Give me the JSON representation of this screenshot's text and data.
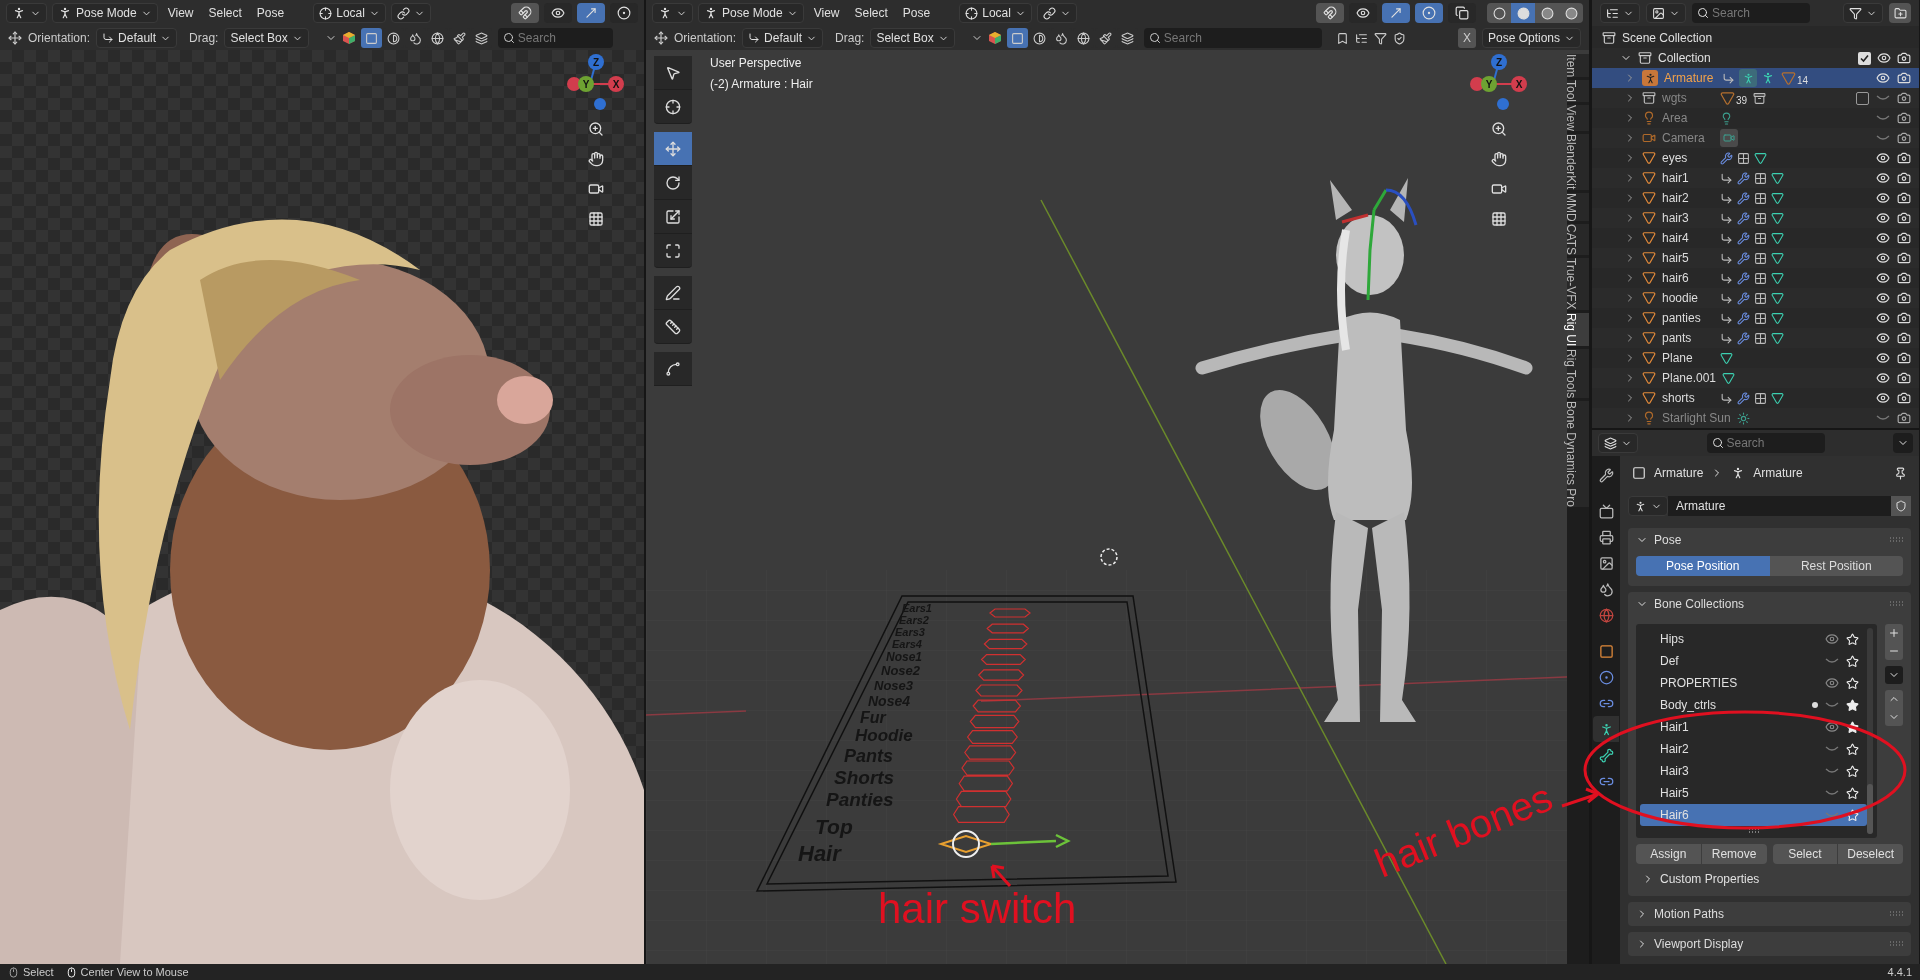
{
  "viewports": [
    {
      "kind": "render",
      "header": {
        "mode": "Pose Mode",
        "menus": [
          "View",
          "Select",
          "Pose"
        ],
        "pivot": "Local",
        "toggles": [
          {
            "kind": "snap",
            "on": true
          },
          {
            "kind": "visibility",
            "on": false
          },
          {
            "kind": "gizmo",
            "on": true
          },
          {
            "kind": "overlay",
            "on": false
          }
        ],
        "orientation_label": "Orientation:",
        "orientation": "Default",
        "drag_label": "Drag:",
        "drag": "Select Box",
        "filters": [
          {
            "kind": "bones",
            "selected": true
          },
          {
            "kind": "shading",
            "selected": false
          },
          {
            "kind": "lights",
            "selected": false
          },
          {
            "kind": "world",
            "selected": false
          },
          {
            "kind": "props",
            "selected": false
          },
          {
            "kind": "data",
            "selected": false
          }
        ],
        "search_placeholder": "Search"
      },
      "gizmo": {
        "x": "X",
        "y": "Y",
        "z": "Z"
      }
    },
    {
      "kind": "solid",
      "header": {
        "mode": "Pose Mode",
        "menus": [
          "View",
          "Select",
          "Pose"
        ],
        "pivot": "Local",
        "toggles": [
          {
            "kind": "snap",
            "on": true
          },
          {
            "kind": "visibility",
            "on": false
          },
          {
            "kind": "gizmo",
            "on": true
          },
          {
            "kind": "overlay",
            "on": true
          },
          {
            "kind": "xray",
            "on": false
          }
        ],
        "shading": [
          {
            "kind": "wireframe",
            "selected": false
          },
          {
            "kind": "solid",
            "selected": true
          },
          {
            "kind": "material",
            "selected": false
          },
          {
            "kind": "rendered",
            "selected": false
          }
        ],
        "orientation_label": "Orientation:",
        "orientation": "Default",
        "drag_label": "Drag:",
        "drag": "Select Box",
        "filters": [
          {
            "kind": "bones",
            "selected": true
          },
          {
            "kind": "shading",
            "selected": false
          },
          {
            "kind": "lights",
            "selected": false
          },
          {
            "kind": "world",
            "selected": false
          },
          {
            "kind": "props",
            "selected": false
          },
          {
            "kind": "data",
            "selected": false
          }
        ],
        "search_placeholder": "Search",
        "x_button": "X",
        "pose_options": "Pose Options"
      },
      "gizmo": {
        "x": "X",
        "y": "Y",
        "z": "Z"
      },
      "overlay_text": [
        "User Perspective",
        "(-2) Armature : Hair"
      ],
      "tools": [
        {
          "kind": "select",
          "selected": false
        },
        {
          "kind": "cursor",
          "selected": false
        },
        {
          "kind": "move",
          "selected": true
        },
        {
          "kind": "rotate",
          "selected": false
        },
        {
          "kind": "scale",
          "selected": false
        },
        {
          "kind": "transform",
          "selected": false
        },
        {
          "kind": "annotate",
          "selected": false
        },
        {
          "kind": "measure",
          "selected": false
        },
        {
          "kind": "bend",
          "selected": false
        }
      ],
      "switch_labels": [
        "Ears1",
        "Ears2",
        "Ears3",
        "Ears4",
        "Nose1",
        "Nose2",
        "Nose3",
        "Nose4",
        "Fur",
        "Hoodie",
        "Pants",
        "Shorts",
        "Panties",
        "Top",
        "Hair"
      ],
      "sidebar_tabs": [
        {
          "label": "Item",
          "selected": false
        },
        {
          "label": "Tool",
          "selected": false
        },
        {
          "label": "View",
          "selected": false
        },
        {
          "label": "BlenderKit",
          "selected": false
        },
        {
          "label": "MMD",
          "selected": false
        },
        {
          "label": "CATS",
          "selected": false
        },
        {
          "label": "True-VFX",
          "selected": false
        },
        {
          "label": "Rig UI",
          "selected": true
        },
        {
          "label": "Rig Tools",
          "selected": false
        },
        {
          "label": "Bone Dynamics Pro",
          "selected": false
        }
      ]
    }
  ],
  "outliner": {
    "search_placeholder": "Search",
    "scene": "Scene Collection",
    "collection": {
      "label": "Collection",
      "checked": true
    },
    "items": [
      {
        "name": "Armature",
        "kind": "armature",
        "selected": true,
        "visible": true,
        "badge": "14"
      },
      {
        "name": "wgts",
        "kind": "collection",
        "selected": false,
        "visible": false,
        "checked": false,
        "badge": "39"
      },
      {
        "name": "Area",
        "kind": "light",
        "selected": false,
        "visible": false
      },
      {
        "name": "Camera",
        "kind": "camera",
        "selected": false,
        "visible": false
      },
      {
        "name": "eyes",
        "kind": "mesh_modified",
        "selected": false,
        "visible": true
      },
      {
        "name": "hair1",
        "kind": "mesh_rigged",
        "selected": false,
        "visible": true
      },
      {
        "name": "hair2",
        "kind": "mesh_rigged",
        "selected": false,
        "visible": true
      },
      {
        "name": "hair3",
        "kind": "mesh_rigged",
        "selected": false,
        "visible": true
      },
      {
        "name": "hair4",
        "kind": "mesh_rigged",
        "selected": false,
        "visible": true
      },
      {
        "name": "hair5",
        "kind": "mesh_rigged",
        "selected": false,
        "visible": true
      },
      {
        "name": "hair6",
        "kind": "mesh_rigged",
        "selected": false,
        "visible": true
      },
      {
        "name": "hoodie",
        "kind": "mesh_rigged",
        "selected": false,
        "visible": true
      },
      {
        "name": "panties",
        "kind": "mesh_rigged",
        "selected": false,
        "visible": true
      },
      {
        "name": "pants",
        "kind": "mesh_rigged",
        "selected": false,
        "visible": true
      },
      {
        "name": "Plane",
        "kind": "mesh",
        "selected": false,
        "visible": true
      },
      {
        "name": "Plane.001",
        "kind": "mesh",
        "selected": false,
        "visible": true
      },
      {
        "name": "shorts",
        "kind": "mesh_rigged",
        "selected": false,
        "visible": true
      },
      {
        "name": "Starlight Sun",
        "kind": "sun_light",
        "selected": false,
        "visible": false
      }
    ]
  },
  "properties": {
    "search_placeholder": "Search",
    "tabs": [
      {
        "kind": "tool",
        "selected": false
      },
      {
        "kind": "render",
        "selected": false
      },
      {
        "kind": "output",
        "selected": false
      },
      {
        "kind": "view_layer",
        "selected": false
      },
      {
        "kind": "scene",
        "selected": false
      },
      {
        "kind": "world",
        "selected": false
      },
      {
        "kind": "object",
        "selected": false
      },
      {
        "kind": "physics",
        "selected": false
      },
      {
        "kind": "constraints",
        "selected": false
      },
      {
        "kind": "data",
        "selected": true
      },
      {
        "kind": "bone",
        "selected": false
      },
      {
        "kind": "bone_constraints",
        "selected": false
      }
    ],
    "breadcrumb": [
      "Armature",
      "Armature"
    ],
    "data_name": "Armature",
    "pose_panel": {
      "title": "Pose",
      "expanded": true,
      "options": [
        {
          "label": "Pose Position",
          "selected": true
        },
        {
          "label": "Rest Position",
          "selected": false
        }
      ]
    },
    "bone_collections": {
      "title": "Bone Collections",
      "expanded": true,
      "items": [
        {
          "name": "Hips",
          "visible": true,
          "solo": false,
          "dot": false,
          "selected": false
        },
        {
          "name": "Def",
          "visible": false,
          "solo": false,
          "dot": false,
          "selected": false
        },
        {
          "name": "PROPERTIES",
          "visible": true,
          "solo": false,
          "dot": false,
          "selected": false
        },
        {
          "name": "Body_ctrls",
          "visible": false,
          "solo": true,
          "dot": true,
          "selected": false
        },
        {
          "name": "Hair1",
          "visible": true,
          "solo": true,
          "dot": false,
          "selected": false
        },
        {
          "name": "Hair2",
          "visible": false,
          "solo": false,
          "dot": false,
          "selected": false
        },
        {
          "name": "Hair3",
          "visible": false,
          "solo": false,
          "dot": false,
          "selected": false
        },
        {
          "name": "Hair5",
          "visible": false,
          "solo": false,
          "dot": false,
          "selected": false
        },
        {
          "name": "Hair6",
          "visible": false,
          "solo": false,
          "dot": false,
          "selected": true
        }
      ],
      "buttons": [
        "Assign",
        "Remove",
        "Select",
        "Deselect"
      ],
      "subpanel": {
        "title": "Custom Properties",
        "expanded": false
      }
    },
    "collapsed_panels": [
      {
        "title": "Motion Paths",
        "expanded": false
      },
      {
        "title": "Viewport Display",
        "expanded": false
      }
    ]
  },
  "annotations": [
    "hair switch",
    "hair bones"
  ],
  "status_bar": {
    "items": [
      {
        "label": "Select",
        "kind": "left_click"
      },
      {
        "label": "Center View to Mouse",
        "kind": "middle_click"
      }
    ],
    "version": "4.4.1"
  }
}
